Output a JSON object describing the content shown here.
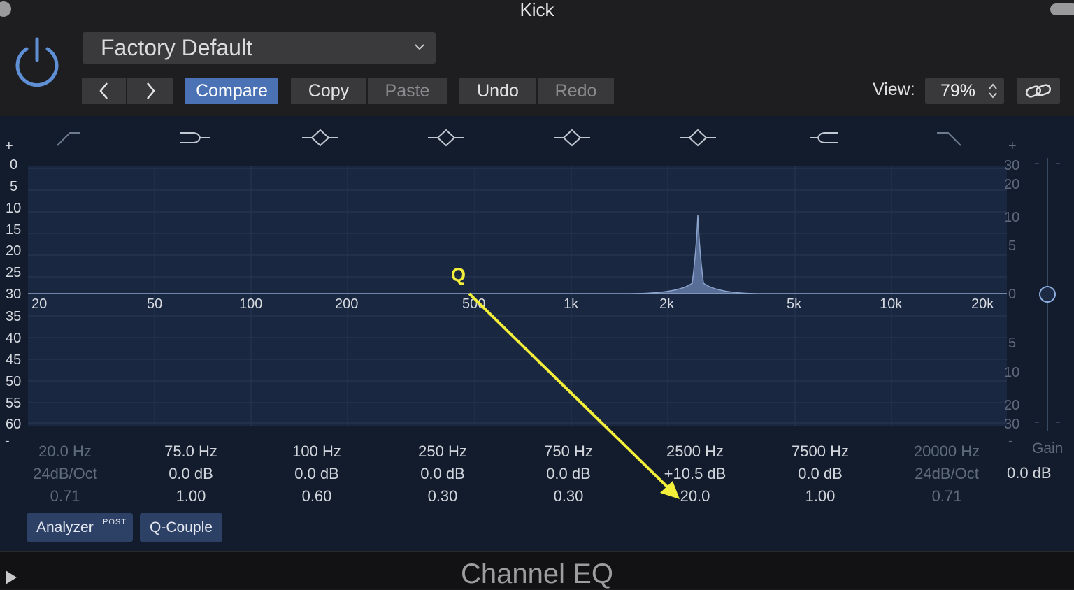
{
  "window": {
    "title": "Kick"
  },
  "header": {
    "preset": "Factory Default",
    "compare": "Compare",
    "copy": "Copy",
    "paste": "Paste",
    "undo": "Undo",
    "redo": "Redo",
    "view_label": "View:",
    "view_value": "79%"
  },
  "graph": {
    "left_db": [
      "+",
      "0",
      "5",
      "10",
      "15",
      "20",
      "25",
      "30",
      "35",
      "40",
      "45",
      "50",
      "55",
      "60",
      "-"
    ],
    "right_db": [
      "+",
      "30",
      "20",
      "10",
      "5",
      "0",
      "5",
      "10",
      "20",
      "30",
      "-"
    ],
    "freq_labels": [
      "20",
      "50",
      "100",
      "200",
      "500",
      "1k",
      "2k",
      "5k",
      "10k",
      "20k"
    ],
    "annotation": "Q"
  },
  "bands": [
    {
      "freq": "20.0 Hz",
      "gain": "24dB/Oct",
      "q": "0.71",
      "enabled": false
    },
    {
      "freq": "75.0 Hz",
      "gain": "0.0 dB",
      "q": "1.00",
      "enabled": true
    },
    {
      "freq": "100 Hz",
      "gain": "0.0 dB",
      "q": "0.60",
      "enabled": true
    },
    {
      "freq": "250 Hz",
      "gain": "0.0 dB",
      "q": "0.30",
      "enabled": true
    },
    {
      "freq": "750 Hz",
      "gain": "0.0 dB",
      "q": "0.30",
      "enabled": true
    },
    {
      "freq": "2500 Hz",
      "gain": "+10.5 dB",
      "q": "20.0",
      "enabled": true
    },
    {
      "freq": "7500 Hz",
      "gain": "0.0 dB",
      "q": "1.00",
      "enabled": true
    },
    {
      "freq": "20000 Hz",
      "gain": "24dB/Oct",
      "q": "0.71",
      "enabled": false
    }
  ],
  "gain": {
    "label": "Gain",
    "value": "0.0 dB"
  },
  "buttons": {
    "analyzer": "Analyzer",
    "analyzer_tag": "POST",
    "qcouple": "Q-Couple"
  },
  "footer": {
    "plugin_name": "Channel EQ"
  },
  "colors": {
    "accent": "#4a72b4",
    "annotation": "#f3ee3a",
    "curve": "#7d95bd"
  }
}
